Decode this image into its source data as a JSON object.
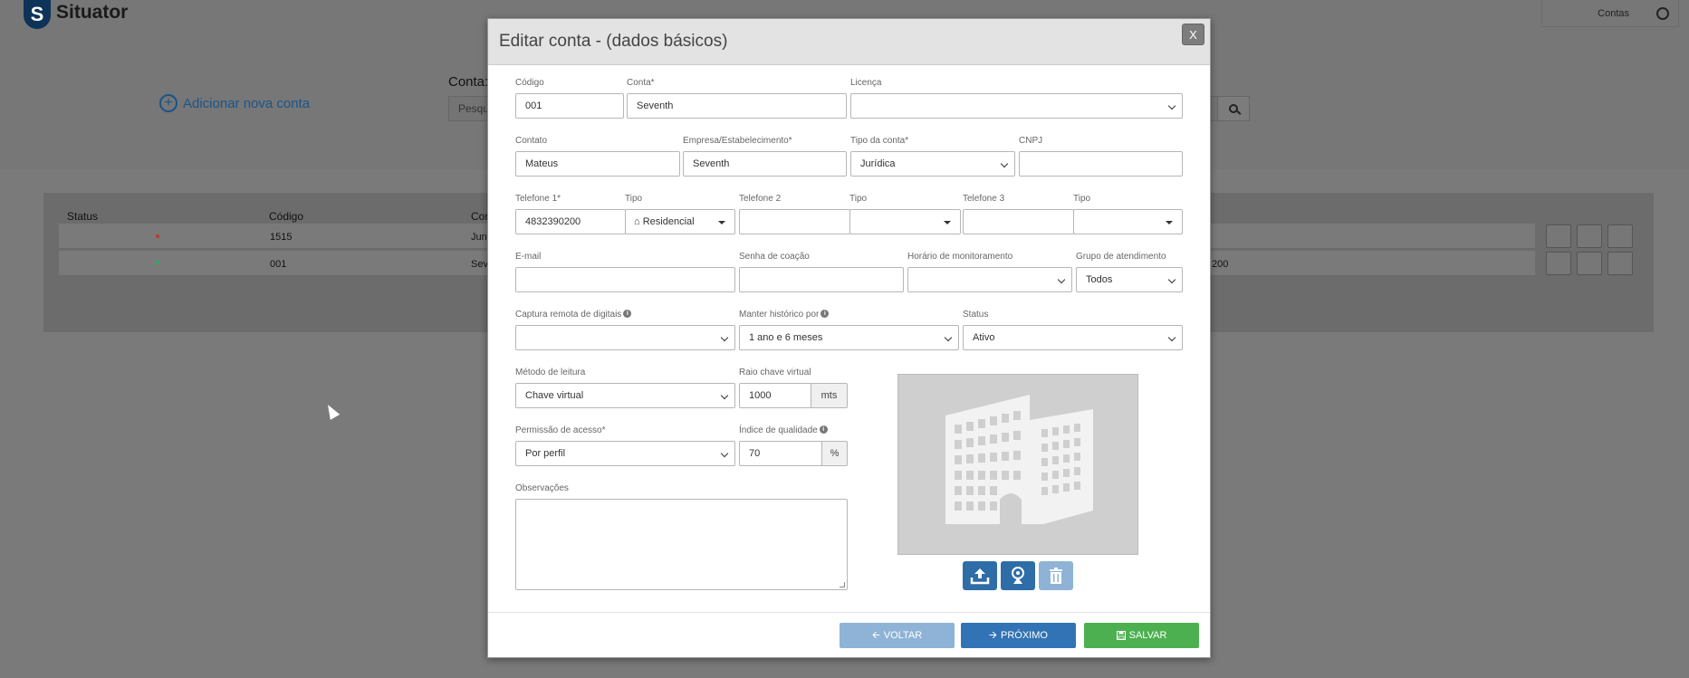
{
  "app": {
    "logo_letter": "S",
    "logo_text": "Situator",
    "user_menu": "Contas"
  },
  "background": {
    "add_account": "Adicionar nova conta",
    "conta_label": "Conta:",
    "search_placeholder": "Pesqu",
    "table": {
      "headers": [
        "Status",
        "Código",
        "Con"
      ],
      "rows": [
        {
          "code": "1515",
          "name": "Jun",
          "status_color": "#c0392b",
          "tail": ""
        },
        {
          "code": "001",
          "name": "Sev",
          "status_color": "#27ae60",
          "tail": "200"
        }
      ]
    }
  },
  "modal": {
    "title": "Editar conta - (dados básicos)",
    "close": "X",
    "fields": {
      "codigo": {
        "label": "Código",
        "value": "001"
      },
      "conta": {
        "label": "Conta*",
        "value": "Seventh"
      },
      "licenca": {
        "label": "Licença",
        "value": ""
      },
      "contato": {
        "label": "Contato",
        "value": "Mateus"
      },
      "empresa": {
        "label": "Empresa/Estabelecimento*",
        "value": "Seventh"
      },
      "tipo_conta": {
        "label": "Tipo da conta*",
        "value": "Jurídica"
      },
      "cnpj": {
        "label": "CNPJ",
        "value": ""
      },
      "telefone1": {
        "label": "Telefone 1*",
        "value": "4832390200"
      },
      "tipo1": {
        "label": "Tipo",
        "value": "Residencial"
      },
      "telefone2": {
        "label": "Telefone 2",
        "value": ""
      },
      "tipo2": {
        "label": "Tipo",
        "value": ""
      },
      "telefone3": {
        "label": "Telefone 3",
        "value": ""
      },
      "tipo3": {
        "label": "Tipo",
        "value": ""
      },
      "email": {
        "label": "E-mail",
        "value": ""
      },
      "senha_coacao": {
        "label": "Senha de coação",
        "value": ""
      },
      "horario": {
        "label": "Horário de monitoramento",
        "value": ""
      },
      "grupo": {
        "label": "Grupo de atendimento",
        "value": "Todos"
      },
      "captura": {
        "label": "Captura remota de digitais",
        "value": ""
      },
      "historico": {
        "label": "Manter histórico por",
        "value": "1 ano e 6 meses"
      },
      "status": {
        "label": "Status",
        "value": "Ativo"
      },
      "metodo": {
        "label": "Método de leitura",
        "value": "Chave virtual"
      },
      "raio": {
        "label": "Raio chave virtual",
        "value": "1000",
        "unit": "mts"
      },
      "permissao": {
        "label": "Permissão de acesso*",
        "value": "Por perfil"
      },
      "indice": {
        "label": "Índice de qualidade",
        "value": "70",
        "unit": "%"
      },
      "observacoes": {
        "label": "Observações",
        "value": ""
      }
    },
    "buttons": {
      "voltar": "VOLTAR",
      "proximo": "PRÓXIMO",
      "salvar": "SALVAR"
    },
    "colors": {
      "voltar": "#8eb3d6",
      "proximo": "#3273b5",
      "salvar": "#4cb050",
      "upload": "#2f6da8",
      "photo_placeholder": "#cfcfcf"
    }
  }
}
